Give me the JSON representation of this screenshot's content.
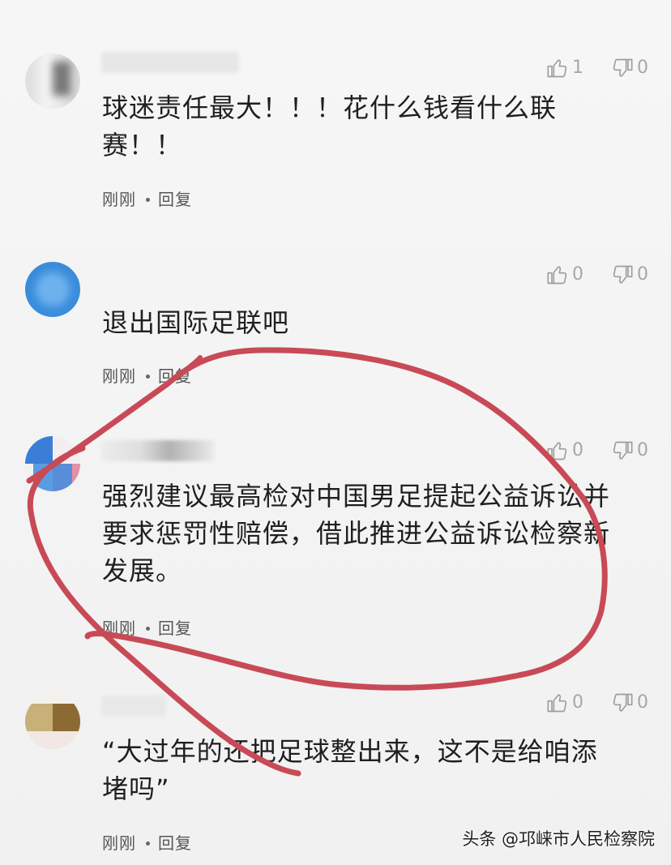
{
  "comments": [
    {
      "likes": "1",
      "dislikes": "0",
      "text_lines": [
        "球迷责任最大！！！花什么钱看什么联",
        "赛！！"
      ],
      "time": "刚刚",
      "reply": "回复",
      "avatar_icon": "blurred-avatar-icon",
      "like_icon": "thumbs-up-icon",
      "dislike_icon": "thumbs-down-icon"
    },
    {
      "likes": "0",
      "dislikes": "0",
      "text_lines": [
        "退出国际足联吧"
      ],
      "time": "刚刚",
      "reply": "回复",
      "avatar_icon": "blue-circle-avatar-icon",
      "like_icon": "thumbs-up-icon",
      "dislike_icon": "thumbs-down-icon"
    },
    {
      "likes": "0",
      "dislikes": "0",
      "text_lines": [
        "强烈建议最高检对中国男足提起公益诉讼并",
        "要求惩罚性赔偿，借此推进公益诉讼检察新",
        "发展。"
      ],
      "time": "刚刚",
      "reply": "回复",
      "avatar_icon": "blue-red-avatar-icon",
      "like_icon": "thumbs-up-icon",
      "dislike_icon": "thumbs-down-icon"
    },
    {
      "likes": "0",
      "dislikes": "0",
      "text_lines": [
        "“大过年的还把足球整出来，这不是给咱添",
        "堵吗”"
      ],
      "time": "刚刚",
      "reply": "回复",
      "avatar_icon": "blurred-avatar-icon",
      "like_icon": "thumbs-up-icon",
      "dislike_icon": "thumbs-down-icon"
    }
  ],
  "watermark": "头条 @邛崃市人民检察院",
  "colors": {
    "annotation": "#c84a56",
    "avatar_blue": "#3a8ddb",
    "icon_gray": "#a7a7a7"
  }
}
